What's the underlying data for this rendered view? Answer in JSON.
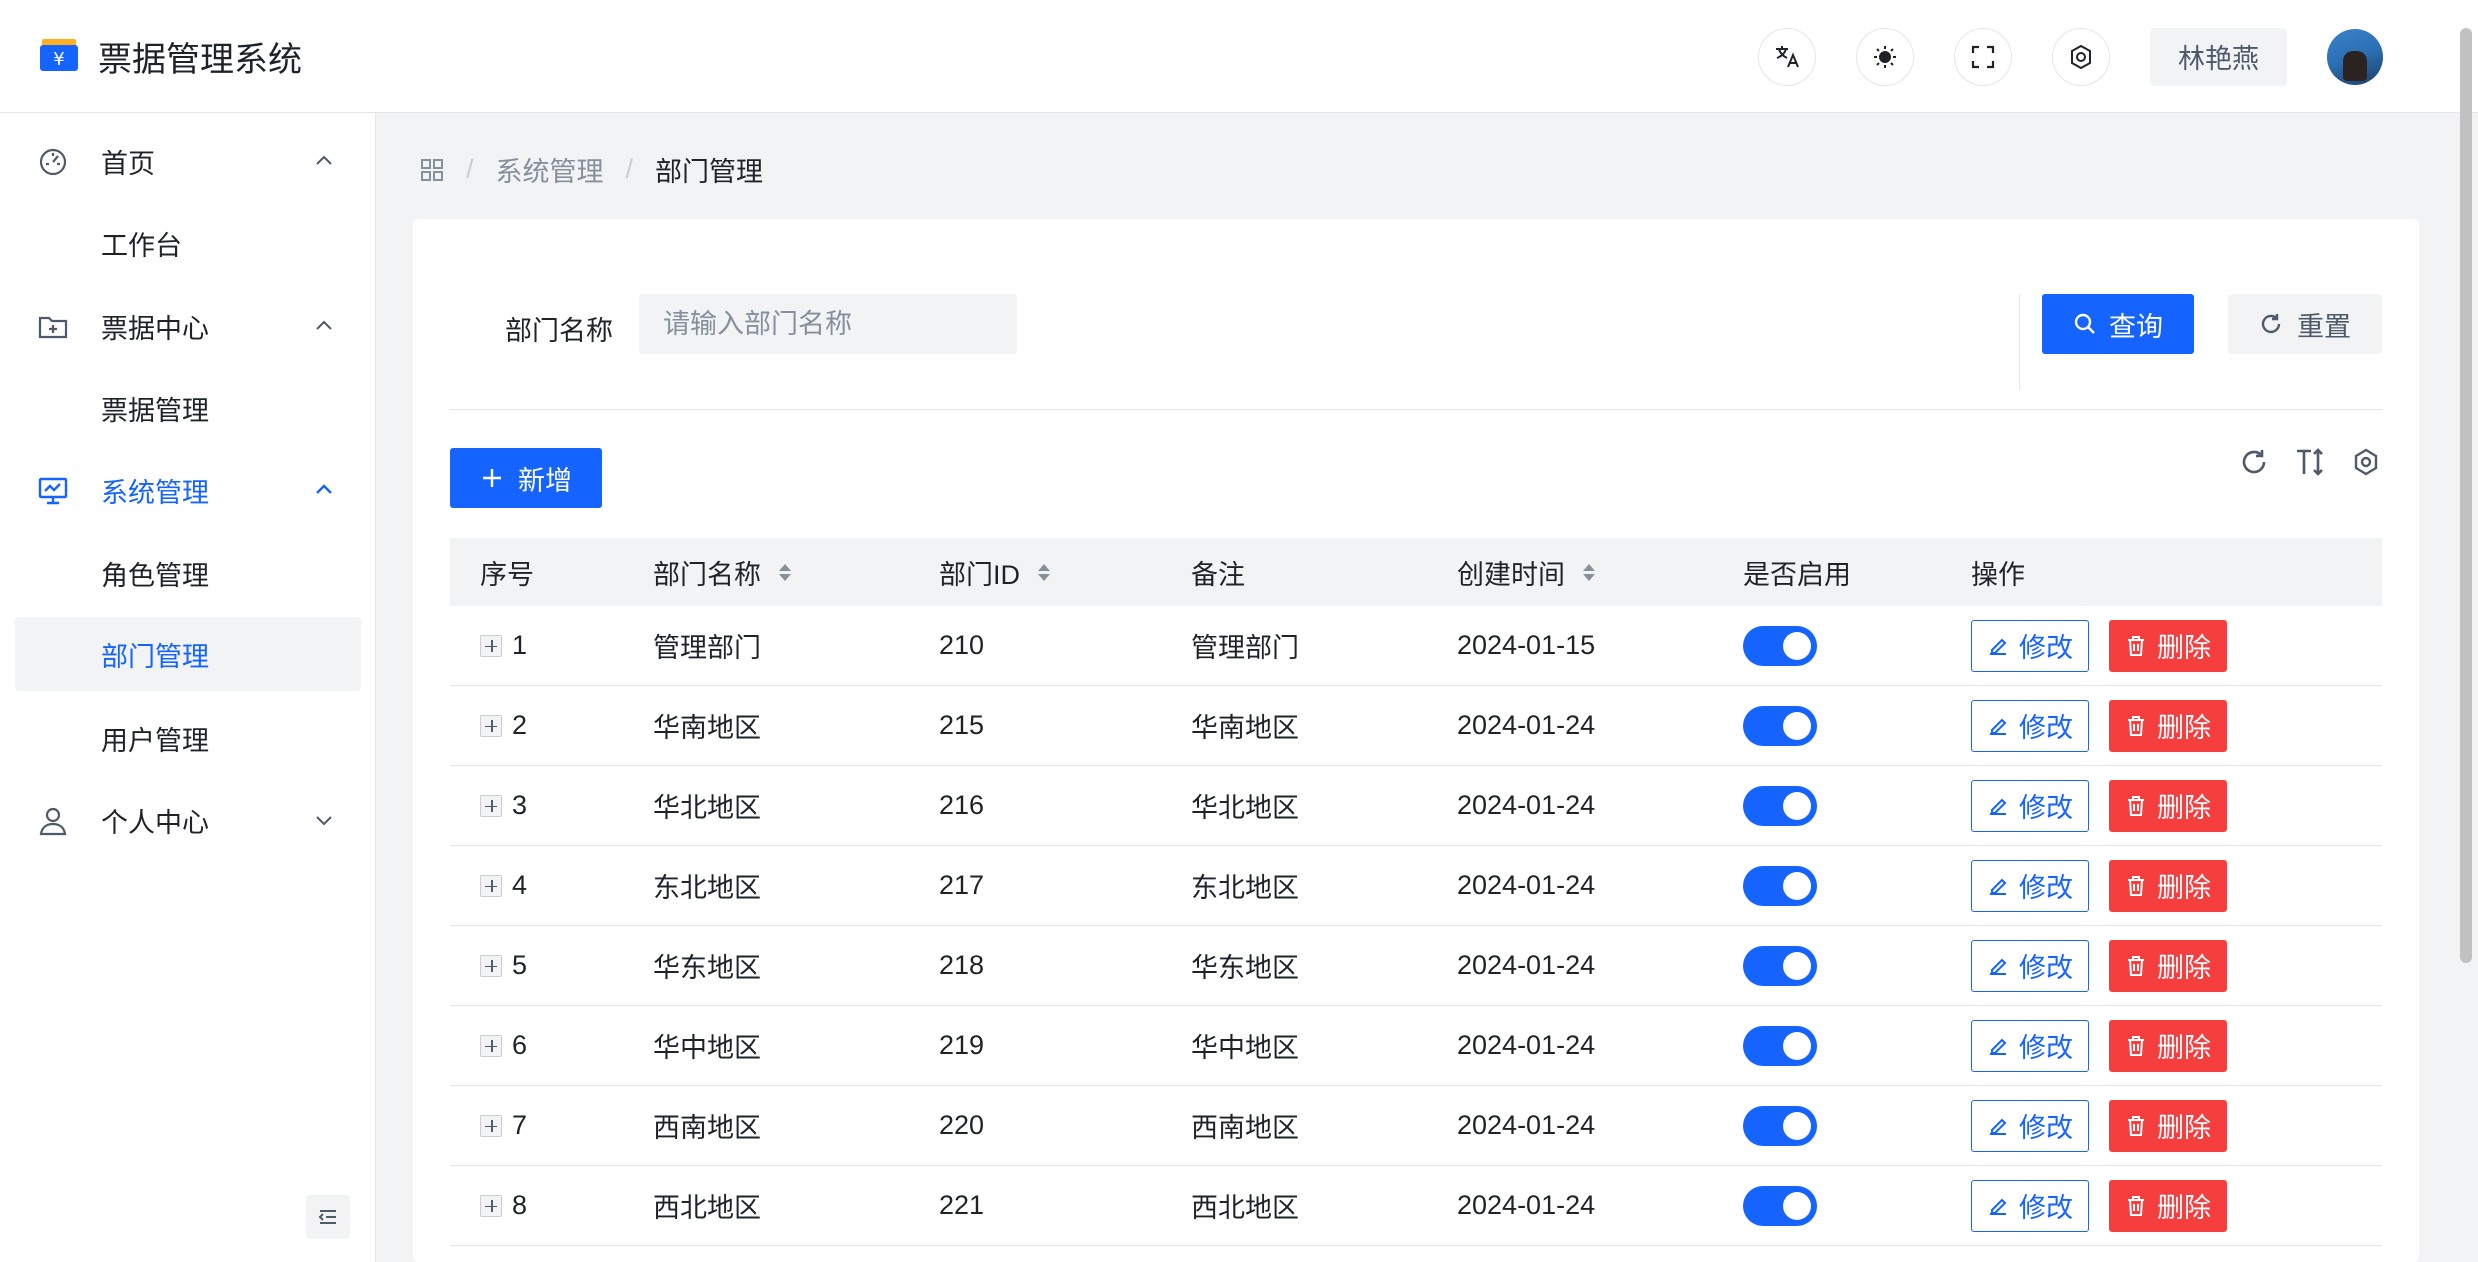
{
  "app": {
    "title": "票据管理系统",
    "logo_glyph": "¥"
  },
  "header": {
    "translate_icon": "translate-icon",
    "theme_icon": "sun-icon",
    "fullscreen_icon": "fullscreen-icon",
    "settings_icon": "gear-icon",
    "user_name": "林艳燕"
  },
  "sidebar": {
    "items": [
      {
        "label": "首页",
        "icon": "dashboard-icon",
        "expanded": true
      },
      {
        "label": "工作台"
      },
      {
        "label": "票据中心",
        "icon": "folder-plus-icon",
        "expanded": true
      },
      {
        "label": "票据管理"
      },
      {
        "label": "系统管理",
        "icon": "monitor-icon",
        "expanded": true
      },
      {
        "label": "角色管理"
      },
      {
        "label": "部门管理"
      },
      {
        "label": "用户管理"
      },
      {
        "label": "个人中心",
        "icon": "user-icon",
        "expanded": false
      }
    ]
  },
  "breadcrumb": {
    "sep": "/",
    "items": [
      "系统管理",
      "部门管理"
    ]
  },
  "search": {
    "label": "部门名称",
    "placeholder": "请输入部门名称",
    "query_label": "查询",
    "reset_label": "重置"
  },
  "toolbar": {
    "add_label": "新增"
  },
  "table": {
    "columns": [
      "序号",
      "部门名称",
      "部门ID",
      "备注",
      "创建时间",
      "是否启用",
      "操作"
    ],
    "edit_label": "修改",
    "delete_label": "删除",
    "rows": [
      {
        "index": "1",
        "name": "管理部门",
        "id": "210",
        "remark": "管理部门",
        "created": "2024-01-15",
        "enabled": true
      },
      {
        "index": "2",
        "name": "华南地区",
        "id": "215",
        "remark": "华南地区",
        "created": "2024-01-24",
        "enabled": true
      },
      {
        "index": "3",
        "name": "华北地区",
        "id": "216",
        "remark": "华北地区",
        "created": "2024-01-24",
        "enabled": true
      },
      {
        "index": "4",
        "name": "东北地区",
        "id": "217",
        "remark": "东北地区",
        "created": "2024-01-24",
        "enabled": true
      },
      {
        "index": "5",
        "name": "华东地区",
        "id": "218",
        "remark": "华东地区",
        "created": "2024-01-24",
        "enabled": true
      },
      {
        "index": "6",
        "name": "华中地区",
        "id": "219",
        "remark": "华中地区",
        "created": "2024-01-24",
        "enabled": true
      },
      {
        "index": "7",
        "name": "西南地区",
        "id": "220",
        "remark": "西南地区",
        "created": "2024-01-24",
        "enabled": true
      },
      {
        "index": "8",
        "name": "西北地区",
        "id": "221",
        "remark": "西北地区",
        "created": "2024-01-24",
        "enabled": true
      }
    ]
  },
  "colors": {
    "primary": "#1664ff",
    "danger": "#f53f3f",
    "bg": "#f2f3f5"
  }
}
